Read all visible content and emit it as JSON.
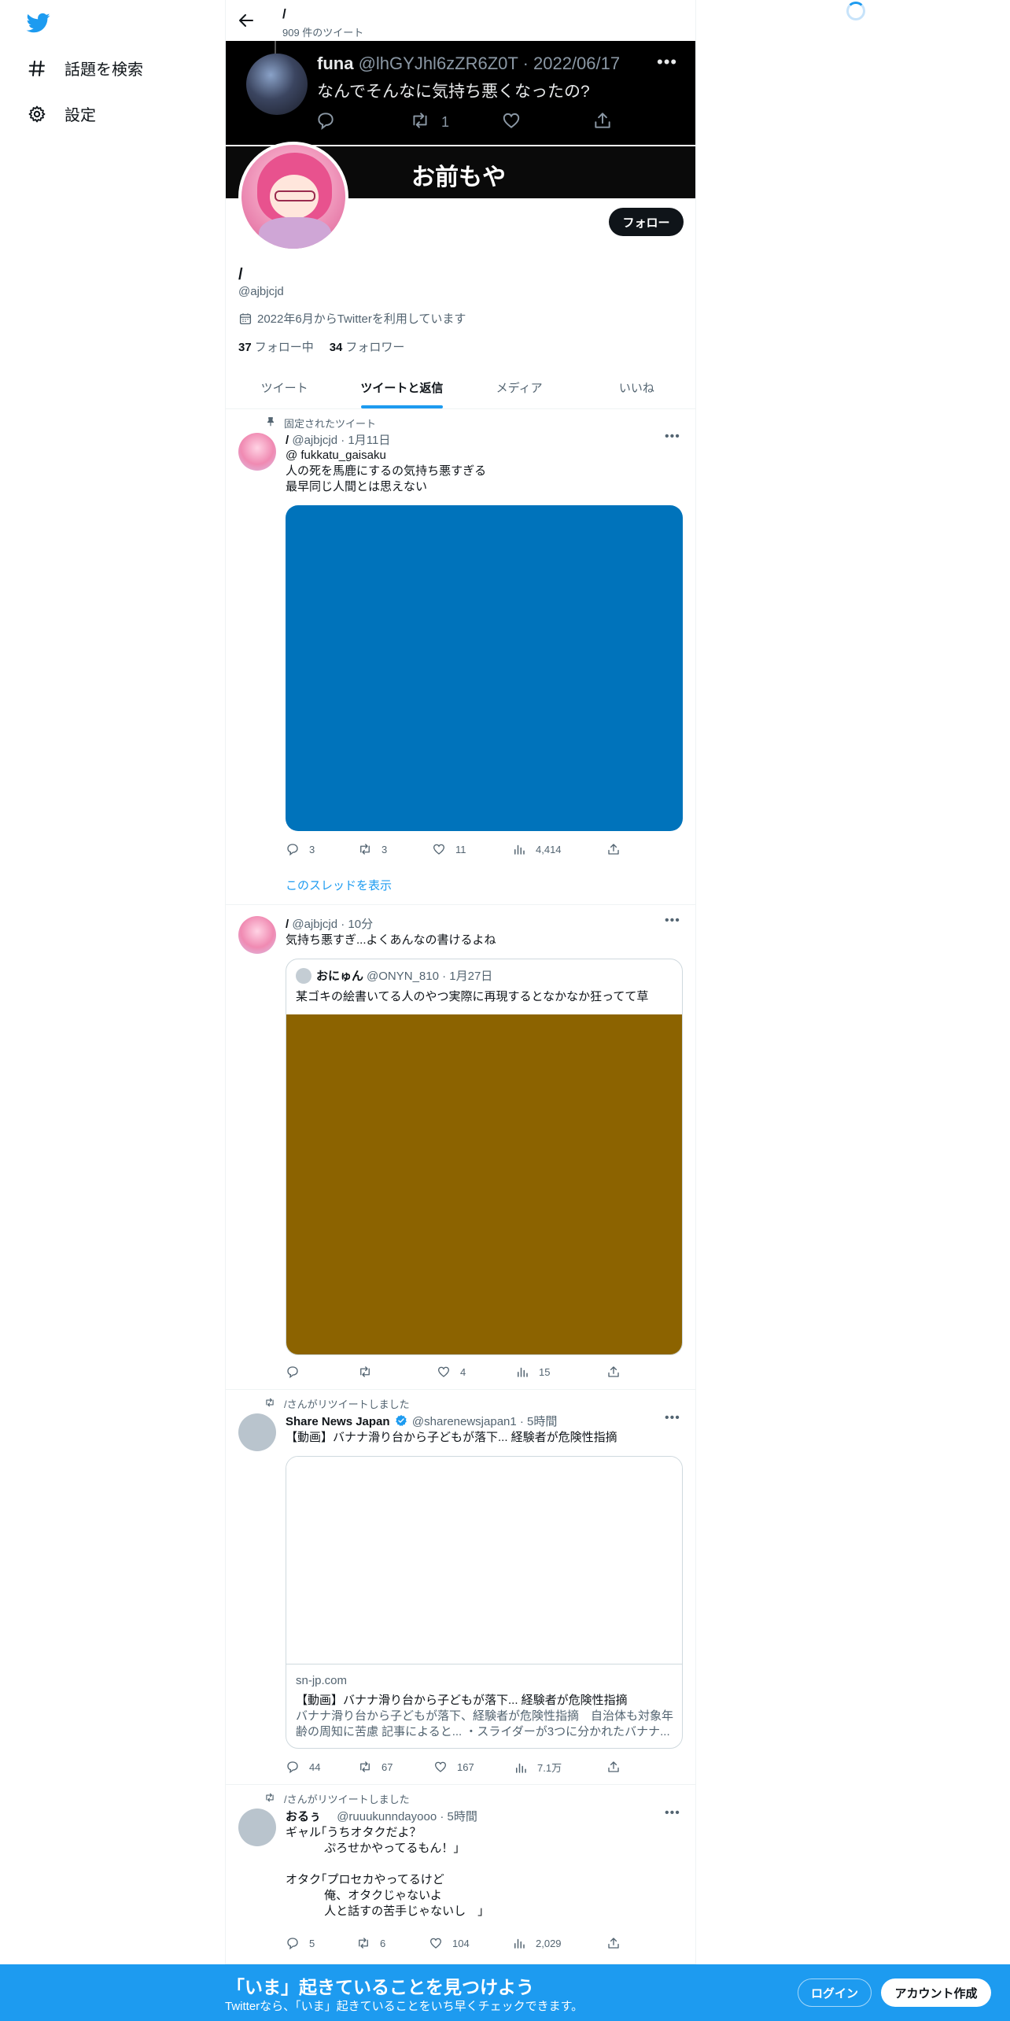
{
  "sidebar": {
    "items": [
      {
        "label": "話題を検索",
        "icon": "hashtag-icon"
      },
      {
        "label": "設定",
        "icon": "gear-icon"
      }
    ]
  },
  "header": {
    "title": "/",
    "tweet_count": "909 件のツイート"
  },
  "banner": {
    "name": "funa",
    "meta": "@lhGYJhl6zZR6Z0T · 2022/06/17",
    "text": "なんでそんなに気持ち悪くなったの?",
    "retweets": "1",
    "big_text": "お前もや"
  },
  "profile": {
    "name": "/",
    "handle": "@ajbjcjd",
    "joined": "2022年6月からTwitterを利用しています",
    "following_count": "37",
    "following_label": "フォロー中",
    "followers_count": "34",
    "followers_label": "フォロワー",
    "follow_button": "フォロー"
  },
  "tabs": [
    {
      "label": "ツイート",
      "active": false
    },
    {
      "label": "ツイートと返信",
      "active": true
    },
    {
      "label": "メディア",
      "active": false
    },
    {
      "label": "いいね",
      "active": false
    }
  ],
  "tweets": [
    {
      "social": "固定されたツイート",
      "name": "/",
      "meta": "@ajbjcjd · 1月11日",
      "text": "@ fukkatu_gaisaku\n人の死を馬鹿にするの気持ち悪すぎる\n最早同じ人間とは思えない",
      "media_color": "#0073bb",
      "replies": "3",
      "retweets": "3",
      "likes": "11",
      "views": "4,414",
      "thread_link": "このスレッドを表示"
    },
    {
      "name": "/",
      "meta": "@ajbjcjd · 10分",
      "text": "気持ち悪すぎ...よくあんなの書けるよね",
      "quote": {
        "name": "おにゅん",
        "meta": "@ONYN_810 · 1月27日",
        "text": "某ゴキの絵書いてる人のやつ実際に再現するとなかなか狂ってて草",
        "media_color": "#8c6300"
      },
      "replies": "",
      "retweets": "",
      "likes": "4",
      "views": "15"
    },
    {
      "social": "/さんがリツイートしました",
      "name": "Share News Japan",
      "meta": "@sharenewsjapan1 · 5時間",
      "text": "【動画】バナナ滑り台から子どもが落下... 経験者が危険性指摘",
      "card": {
        "domain": "sn-jp.com",
        "title": "【動画】バナナ滑り台から子どもが落下... 経験者が危険性指摘",
        "desc": "バナナ滑り台から子どもが落下、経験者が危険性指摘　自治体も対象年齢の周知に苦慮 記事によると... ・スライダーが3つに分かれたバナナ..."
      },
      "replies": "44",
      "retweets": "67",
      "likes": "167",
      "views": "7.1万"
    },
    {
      "social": "/さんがリツイートしました",
      "name": "おるぅ",
      "meta": "@ruuukunndayooo · 5時間",
      "text": "ギャル｢うちオタクだよ？\n　　　 ぷろせかやってるもん！｣\n\nオタク｢プロセカやってるけど\n　　　 俺、オタクじゃないよ\n　　　 人と話すの苦手じゃないし　｣",
      "replies": "5",
      "retweets": "6",
      "likes": "104",
      "views": "2,029"
    }
  ],
  "bottom_bar": {
    "title": "「いま」起きていることを見つけよう",
    "subtitle": "Twitterなら、「いま」起きていることをいち早くチェックできます。",
    "login": "ログイン",
    "signup": "アカウント作成"
  },
  "colors": {
    "accent": "#1d9bf0",
    "text": "#0f1419",
    "muted": "#536471"
  }
}
